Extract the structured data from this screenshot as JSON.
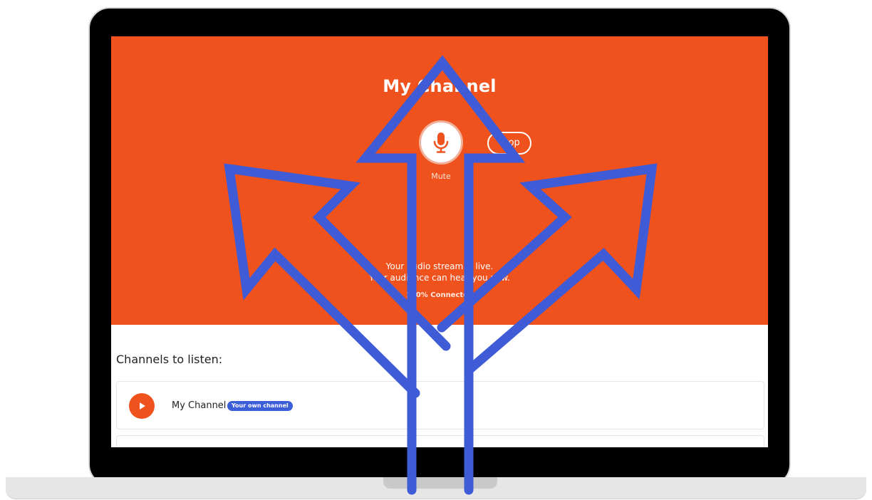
{
  "hero": {
    "title": "My Channel",
    "mic_icon": "microphone-icon",
    "mute_label": "Mute",
    "stop_label": "Stop",
    "status_line_1": "Your audio stream is live.",
    "status_line_2": "Your audience can hear you now.",
    "connection_status": "100% Connected"
  },
  "listen": {
    "heading": "Channels to listen:",
    "channels": [
      {
        "name": "My Channel",
        "badge": "Your own channel",
        "icon": "play-icon"
      }
    ]
  },
  "overlay": {
    "icon": "three-way-arrows-icon",
    "color": "#3f5bd6"
  },
  "colors": {
    "accent": "#ef521c",
    "badge": "#3d5ed9"
  }
}
